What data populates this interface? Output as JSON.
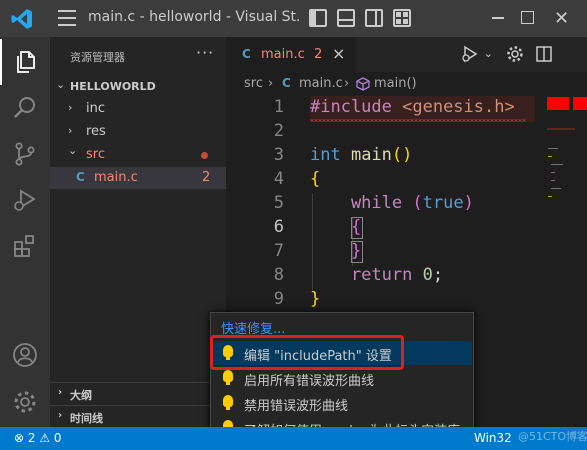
{
  "titlebar": {
    "title": "main.c - helloworld - Visual St..."
  },
  "activity_bar": {
    "items": [
      "files-icon",
      "search-icon",
      "source-control-icon",
      "run-debug-icon",
      "extensions-icon",
      "account-icon",
      "settings-gear-icon"
    ]
  },
  "sidebar": {
    "title": "资源管理器",
    "more": "···",
    "root": "HELLOWORLD",
    "items": [
      {
        "label": "inc",
        "chevron": "›"
      },
      {
        "label": "res",
        "chevron": "›"
      },
      {
        "label": "src",
        "chevron": "⌄"
      },
      {
        "label": "main.c",
        "badge": "C",
        "problems": "2"
      }
    ],
    "panels": [
      {
        "label": "大纲"
      },
      {
        "label": "时间线"
      }
    ]
  },
  "tab": {
    "badge": "C",
    "name": "main.c",
    "problems": "2",
    "close": "×"
  },
  "breadcrumb": {
    "folder": "src",
    "file_badge": "C",
    "file": "main.c",
    "symbol": "main()"
  },
  "editor": {
    "line_numbers": [
      "1",
      "2",
      "3",
      "4",
      "5",
      "6",
      "7",
      "8",
      "9"
    ],
    "lines": [
      {
        "directive": "#include",
        "arg": " <genesis.h>"
      },
      {},
      {
        "type": "int",
        "name": " main",
        "parens": "()"
      },
      {
        "brace": "{"
      },
      {
        "keyword": "    while",
        "open": " (",
        "value": "true",
        "close": ")"
      },
      {
        "brace": "    {"
      },
      {
        "brace": "    }"
      },
      {
        "keyword": "    return",
        "value": " 0",
        "end": ";"
      },
      {
        "brace": "}"
      }
    ]
  },
  "quickfix": {
    "title": "快速修复...",
    "items": [
      "编辑 \"includePath\" 设置",
      "启用所有错误波形曲线",
      "禁用错误波形曲线",
      "了解如何使用 vcpkg 为此标头安装库"
    ]
  },
  "statusbar": {
    "problems": "⊗ 2 ⚠ 0",
    "platform": "Win32"
  },
  "watermark": "@51CTO博客"
}
